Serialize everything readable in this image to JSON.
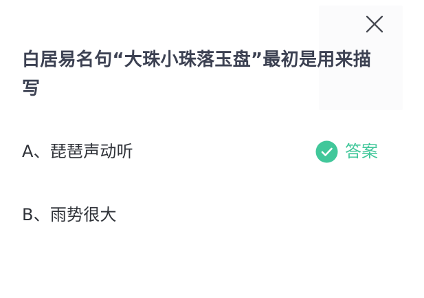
{
  "question": {
    "text": "白居易名句“大珠小珠落玉盘”最初是用来描写"
  },
  "options": [
    {
      "label": "A、琵琶声动听",
      "is_answer": true
    },
    {
      "label": "B、雨势很大",
      "is_answer": false
    }
  ],
  "answer_badge": {
    "label": "答案",
    "icon": "check-circle-icon",
    "color": "#41c79a"
  },
  "close": {
    "icon": "close-icon"
  }
}
